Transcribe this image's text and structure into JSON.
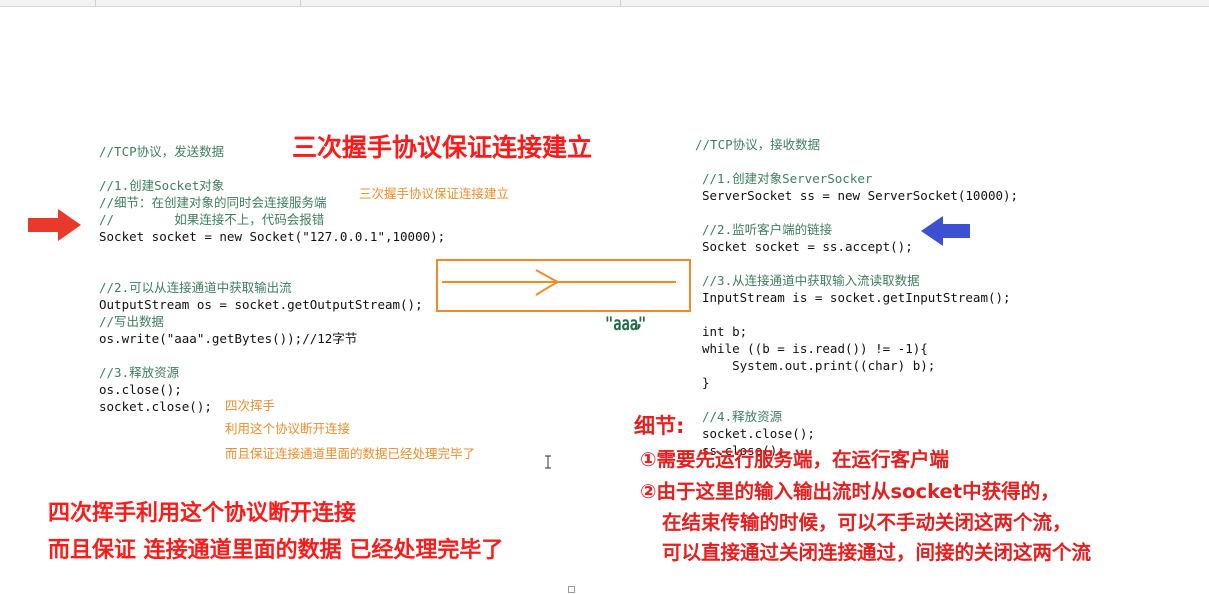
{
  "client_code": {
    "comment_title": "//TCP协议，发送数据",
    "step1_comment": "//1.创建Socket对象",
    "detail_comment": "//细节：在创建对象的同时会连接服务端",
    "fail_comment": "//        如果连接不上，代码会报错",
    "socket_line": "Socket socket = new Socket(\"127.0.0.1\",10000);",
    "step2_comment": "//2.可以从连接通道中获取输出流",
    "output_line": "OutputStream os = socket.getOutputStream();",
    "write_comment": "//写出数据",
    "write_line": "os.write(\"aaa\".getBytes());//12字节",
    "step3_comment": "//3.释放资源",
    "close_os": "os.close();",
    "close_socket": "socket.close();"
  },
  "server_code": {
    "comment_title": "//TCP协议，接收数据",
    "step1_comment": "//1.创建对象ServerSocker",
    "server_line": "ServerSocket ss = new ServerSocket(10000);",
    "step2_comment": "//2.监听客户端的链接",
    "accept_line": "Socket socket = ss.accept();",
    "step3_comment": "//3.从连接通道中获取输入流读取数据",
    "input_line": "InputStream is = socket.getInputStream();",
    "int_line": "int b;",
    "while_line": "while ((b = is.read()) != -1){",
    "print_line": "    System.out.print((char) b);",
    "close_brace": "}",
    "step4_comment": "//4.释放资源",
    "close_socket": "socket.close();",
    "close_ss": "ss.close();"
  },
  "annotations": {
    "three_way_big": "三次握手协议保证连接建立",
    "three_way_small": "三次握手协议保证连接建立",
    "four_wave_1": "四次挥手",
    "four_wave_2": "利用这个协议断开连接",
    "four_wave_3": "而且保证连接通道里面的数据已经处理完毕了",
    "bottom_line_1": "四次挥手利用这个协议断开连接",
    "bottom_line_2": "而且保证 连接通道里面的数据 已经处理完毕了",
    "aaa_label": "\"aaa\"",
    "details_title": "细节:",
    "detail_1": "①需要先运行服务端，在运行客户端",
    "detail_2": "②由于这里的输入输出流时从socket中获得的，",
    "detail_3": "在结束传输的时候，可以不手动关闭这两个流，",
    "detail_4": "可以直接通过关闭连接通过，间接的关闭这两个流"
  },
  "colors": {
    "red_arrow": "#e8392a",
    "blue_arrow": "#3c50d2",
    "orange": "#f08c28",
    "big_red": "#ff1a1a",
    "aaa_green": "#1e6e46"
  },
  "icons": [
    "red-arrow-icon",
    "blue-arrow-icon",
    "text-cursor-icon"
  ]
}
